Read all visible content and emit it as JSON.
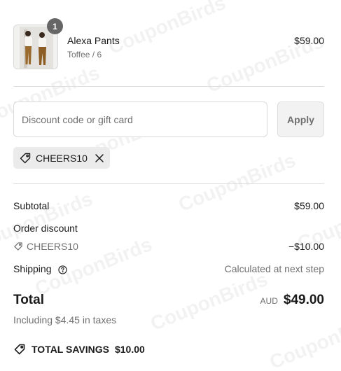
{
  "watermark": "CouponBirds",
  "product": {
    "name": "Alexa Pants",
    "variant": "Toffee / 6",
    "price": "$59.00",
    "quantity": "1"
  },
  "discount": {
    "placeholder": "Discount code or gift card",
    "apply_label": "Apply",
    "applied_code": "CHEERS10"
  },
  "summary": {
    "subtotal_label": "Subtotal",
    "subtotal_value": "$59.00",
    "order_discount_label": "Order discount",
    "discount_code": "CHEERS10",
    "discount_value": "−$10.00",
    "shipping_label": "Shipping",
    "shipping_value": "Calculated at next step",
    "total_label": "Total",
    "currency": "AUD",
    "total_value": "$49.00",
    "taxes_note": "Including $4.45 in taxes",
    "savings_label": "TOTAL SAVINGS",
    "savings_value": "$10.00"
  },
  "icons": {
    "tag": "tag-icon",
    "remove": "close-icon",
    "help": "question-circle-icon"
  }
}
